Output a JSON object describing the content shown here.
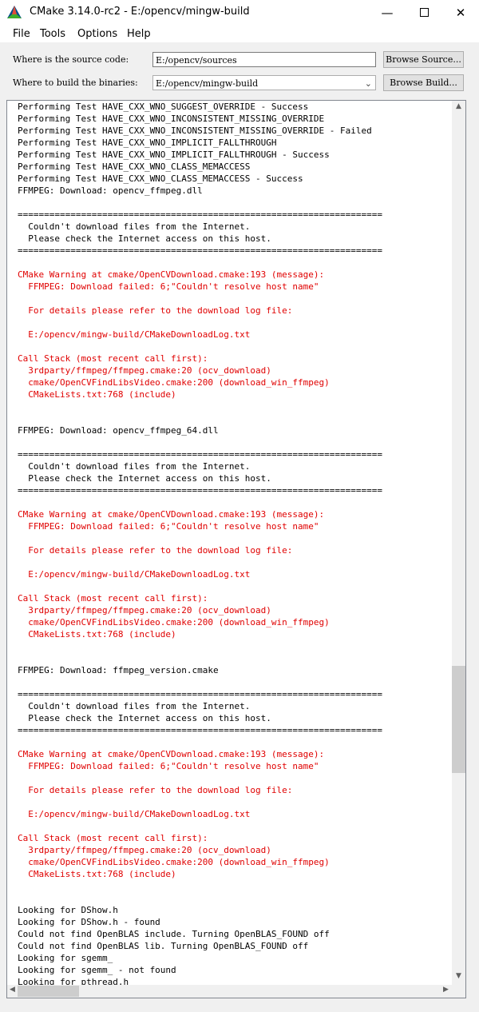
{
  "window": {
    "title": "CMake 3.14.0-rc2 - E:/opencv/mingw-build"
  },
  "menu": [
    "File",
    "Tools",
    "Options",
    "Help"
  ],
  "source": {
    "label": "Where is the source code:",
    "value": "E:/opencv/sources",
    "button": "Browse Source..."
  },
  "build": {
    "label": "Where to build the binaries:",
    "value": "E:/opencv/mingw-build",
    "button": "Browse Build..."
  },
  "output": {
    "lines": [
      {
        "t": "Performing Test HAVE_CXX_WNO_SUGGEST_OVERRIDE - Success",
        "c": "normal"
      },
      {
        "t": "Performing Test HAVE_CXX_WNO_INCONSISTENT_MISSING_OVERRIDE",
        "c": "normal"
      },
      {
        "t": "Performing Test HAVE_CXX_WNO_INCONSISTENT_MISSING_OVERRIDE - Failed",
        "c": "normal"
      },
      {
        "t": "Performing Test HAVE_CXX_WNO_IMPLICIT_FALLTHROUGH",
        "c": "normal"
      },
      {
        "t": "Performing Test HAVE_CXX_WNO_IMPLICIT_FALLTHROUGH - Success",
        "c": "normal"
      },
      {
        "t": "Performing Test HAVE_CXX_WNO_CLASS_MEMACCESS",
        "c": "normal"
      },
      {
        "t": "Performing Test HAVE_CXX_WNO_CLASS_MEMACCESS - Success",
        "c": "normal"
      },
      {
        "t": "FFMPEG: Download: opencv_ffmpeg.dll",
        "c": "normal"
      },
      {
        "t": "",
        "c": "normal"
      },
      {
        "t": "=====================================================================",
        "c": "normal"
      },
      {
        "t": "  Couldn't download files from the Internet.",
        "c": "normal"
      },
      {
        "t": "  Please check the Internet access on this host.",
        "c": "normal"
      },
      {
        "t": "=====================================================================",
        "c": "normal"
      },
      {
        "t": "",
        "c": "normal"
      },
      {
        "t": "CMake Warning at cmake/OpenCVDownload.cmake:193 (message):",
        "c": "red"
      },
      {
        "t": "  FFMPEG: Download failed: 6;\"Couldn't resolve host name\"",
        "c": "red"
      },
      {
        "t": "",
        "c": "red"
      },
      {
        "t": "  For details please refer to the download log file:",
        "c": "red"
      },
      {
        "t": "",
        "c": "red"
      },
      {
        "t": "  E:/opencv/mingw-build/CMakeDownloadLog.txt",
        "c": "red"
      },
      {
        "t": "",
        "c": "red"
      },
      {
        "t": "Call Stack (most recent call first):",
        "c": "red"
      },
      {
        "t": "  3rdparty/ffmpeg/ffmpeg.cmake:20 (ocv_download)",
        "c": "red"
      },
      {
        "t": "  cmake/OpenCVFindLibsVideo.cmake:200 (download_win_ffmpeg)",
        "c": "red"
      },
      {
        "t": "  CMakeLists.txt:768 (include)",
        "c": "red"
      },
      {
        "t": "",
        "c": "normal"
      },
      {
        "t": "",
        "c": "normal"
      },
      {
        "t": "FFMPEG: Download: opencv_ffmpeg_64.dll",
        "c": "normal"
      },
      {
        "t": "",
        "c": "normal"
      },
      {
        "t": "=====================================================================",
        "c": "normal"
      },
      {
        "t": "  Couldn't download files from the Internet.",
        "c": "normal"
      },
      {
        "t": "  Please check the Internet access on this host.",
        "c": "normal"
      },
      {
        "t": "=====================================================================",
        "c": "normal"
      },
      {
        "t": "",
        "c": "normal"
      },
      {
        "t": "CMake Warning at cmake/OpenCVDownload.cmake:193 (message):",
        "c": "red"
      },
      {
        "t": "  FFMPEG: Download failed: 6;\"Couldn't resolve host name\"",
        "c": "red"
      },
      {
        "t": "",
        "c": "red"
      },
      {
        "t": "  For details please refer to the download log file:",
        "c": "red"
      },
      {
        "t": "",
        "c": "red"
      },
      {
        "t": "  E:/opencv/mingw-build/CMakeDownloadLog.txt",
        "c": "red"
      },
      {
        "t": "",
        "c": "red"
      },
      {
        "t": "Call Stack (most recent call first):",
        "c": "red"
      },
      {
        "t": "  3rdparty/ffmpeg/ffmpeg.cmake:20 (ocv_download)",
        "c": "red"
      },
      {
        "t": "  cmake/OpenCVFindLibsVideo.cmake:200 (download_win_ffmpeg)",
        "c": "red"
      },
      {
        "t": "  CMakeLists.txt:768 (include)",
        "c": "red"
      },
      {
        "t": "",
        "c": "normal"
      },
      {
        "t": "",
        "c": "normal"
      },
      {
        "t": "FFMPEG: Download: ffmpeg_version.cmake",
        "c": "normal"
      },
      {
        "t": "",
        "c": "normal"
      },
      {
        "t": "=====================================================================",
        "c": "normal"
      },
      {
        "t": "  Couldn't download files from the Internet.",
        "c": "normal"
      },
      {
        "t": "  Please check the Internet access on this host.",
        "c": "normal"
      },
      {
        "t": "=====================================================================",
        "c": "normal"
      },
      {
        "t": "",
        "c": "normal"
      },
      {
        "t": "CMake Warning at cmake/OpenCVDownload.cmake:193 (message):",
        "c": "red"
      },
      {
        "t": "  FFMPEG: Download failed: 6;\"Couldn't resolve host name\"",
        "c": "red"
      },
      {
        "t": "",
        "c": "red"
      },
      {
        "t": "  For details please refer to the download log file:",
        "c": "red"
      },
      {
        "t": "",
        "c": "red"
      },
      {
        "t": "  E:/opencv/mingw-build/CMakeDownloadLog.txt",
        "c": "red"
      },
      {
        "t": "",
        "c": "red"
      },
      {
        "t": "Call Stack (most recent call first):",
        "c": "red"
      },
      {
        "t": "  3rdparty/ffmpeg/ffmpeg.cmake:20 (ocv_download)",
        "c": "red"
      },
      {
        "t": "  cmake/OpenCVFindLibsVideo.cmake:200 (download_win_ffmpeg)",
        "c": "red"
      },
      {
        "t": "  CMakeLists.txt:768 (include)",
        "c": "red"
      },
      {
        "t": "",
        "c": "normal"
      },
      {
        "t": "",
        "c": "normal"
      },
      {
        "t": "Looking for DShow.h",
        "c": "normal"
      },
      {
        "t": "Looking for DShow.h - found",
        "c": "normal"
      },
      {
        "t": "Could not find OpenBLAS include. Turning OpenBLAS_FOUND off",
        "c": "normal"
      },
      {
        "t": "Could not find OpenBLAS lib. Turning OpenBLAS_FOUND off",
        "c": "normal"
      },
      {
        "t": "Looking for sgemm_",
        "c": "normal"
      },
      {
        "t": "Looking for sgemm_ - not found",
        "c": "normal"
      },
      {
        "t": "Looking for pthread.h",
        "c": "normal"
      }
    ]
  }
}
